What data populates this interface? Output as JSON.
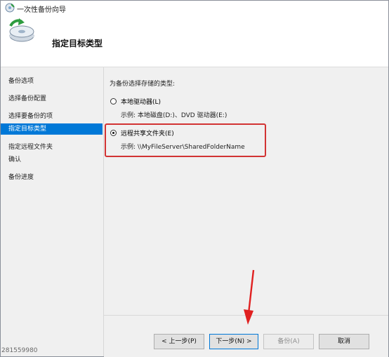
{
  "window": {
    "title": "一次性备份向导"
  },
  "header": {
    "title": "指定目标类型"
  },
  "sidebar": {
    "items": [
      {
        "label": "备份选项",
        "selected": false
      },
      {
        "label": "选择备份配置",
        "selected": false
      },
      {
        "label": "选择要备份的项",
        "selected": false
      },
      {
        "label": "指定目标类型",
        "selected": true
      },
      {
        "label": "指定远程文件夹",
        "selected": false
      },
      {
        "label": "确认",
        "selected": false
      },
      {
        "label": "备份进度",
        "selected": false
      }
    ]
  },
  "main": {
    "prompt": "为备份选择存储的类型:",
    "options": [
      {
        "label": "本地驱动器(L)",
        "example": "示例: 本地磁盘(D:)、DVD 驱动器(E:)",
        "checked": false
      },
      {
        "label": "远程共享文件夹(E)",
        "example": "示例: \\\\MyFileServer\\SharedFolderName",
        "checked": true
      }
    ]
  },
  "footer": {
    "buttons": [
      {
        "label": "< 上一步(P)",
        "enabled": true
      },
      {
        "label": "下一步(N) >",
        "enabled": true
      },
      {
        "label": "备份(A)",
        "enabled": false
      },
      {
        "label": "取消",
        "enabled": true
      }
    ]
  },
  "watermark": "281559980",
  "colors": {
    "selection": "#0078d7",
    "highlight_border": "#d23333",
    "annotation_arrow": "#e02020"
  }
}
